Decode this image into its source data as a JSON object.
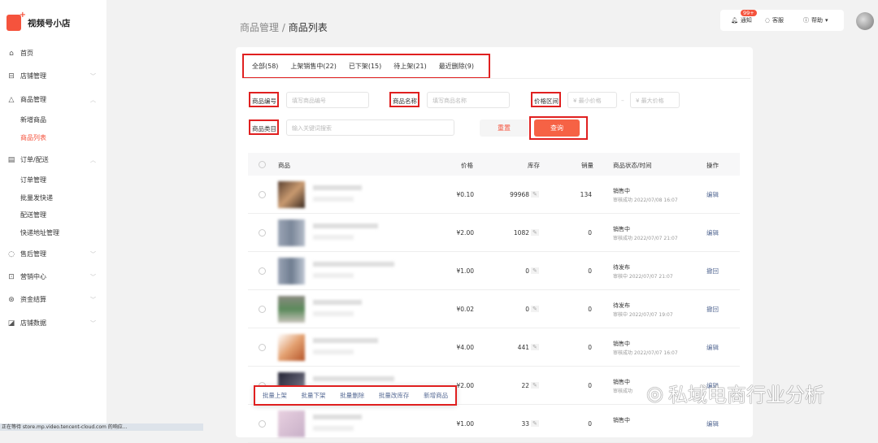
{
  "app": {
    "name": "视频号小店"
  },
  "sidebar": {
    "items": [
      {
        "label": "首页",
        "icon": "home-icon"
      },
      {
        "label": "店铺管理",
        "icon": "store-icon"
      },
      {
        "label": "商品管理",
        "icon": "bag-icon",
        "sub": [
          "新增商品",
          "商品列表"
        ]
      },
      {
        "label": "订单/配送",
        "icon": "order-icon",
        "sub": [
          "订单管理",
          "批量发快递",
          "配送管理",
          "快递地址管理"
        ]
      },
      {
        "label": "售后管理",
        "icon": "headset-icon"
      },
      {
        "label": "营销中心",
        "icon": "marketing-icon"
      },
      {
        "label": "资金结算",
        "icon": "yuan-icon"
      },
      {
        "label": "店铺数据",
        "icon": "chart-icon"
      }
    ]
  },
  "topbar": {
    "notify": "通知",
    "badge": "99+",
    "service": "客服",
    "help": "帮助"
  },
  "breadcrumb": {
    "parent": "商品管理",
    "sep": " / ",
    "current": "商品列表"
  },
  "tabs": [
    "全部(58)",
    "上架销售中(22)",
    "已下架(15)",
    "待上架(21)",
    "最近删除(9)"
  ],
  "filters": {
    "code_label": "商品编号",
    "code_ph": "填写商品编号",
    "name_label": "商品名称",
    "name_ph": "填写商品名称",
    "price_label": "价格区间",
    "min_ph": "¥ 最小价格",
    "dash": "–",
    "max_ph": "¥ 最大价格",
    "cat_label": "商品类目",
    "cat_ph": "输入关键词搜索",
    "reset": "重置",
    "query": "查询"
  },
  "table": {
    "headers": [
      "商品",
      "价格",
      "库存",
      "销量",
      "商品状态/时间",
      "操作"
    ],
    "rows": [
      {
        "price": "¥0.10",
        "stock": "99968",
        "sales": "134",
        "status": "销售中",
        "time": "审核成功 2022/07/08 16:07",
        "op": "编辑"
      },
      {
        "price": "¥2.00",
        "stock": "1082",
        "sales": "0",
        "status": "销售中",
        "time": "审核成功 2022/07/07 21:07",
        "op": "编辑"
      },
      {
        "price": "¥1.00",
        "stock": "0",
        "sales": "0",
        "status": "待发布",
        "time": "审核中 2022/07/07 21:07",
        "op": "撤回"
      },
      {
        "price": "¥0.02",
        "stock": "0",
        "sales": "0",
        "status": "待发布",
        "time": "审核中 2022/07/07 19:07",
        "op": "撤回"
      },
      {
        "price": "¥4.00",
        "stock": "441",
        "sales": "0",
        "status": "销售中",
        "time": "审核成功 2022/07/07 16:07",
        "op": "编辑"
      },
      {
        "price": "¥2.00",
        "stock": "22",
        "sales": "0",
        "status": "销售中",
        "time": "审核成功",
        "op": "编辑"
      },
      {
        "price": "¥1.00",
        "stock": "33",
        "sales": "0",
        "status": "销售中",
        "time": "",
        "op": "编辑"
      }
    ]
  },
  "batch": [
    "批量上架",
    "批量下架",
    "批量删除",
    "批量改库存",
    "新增商品"
  ],
  "statusbar": "正在等待 store.mp.video.tencent-cloud.com 的响应...",
  "watermark": "私域电商行业分析",
  "colors": {
    "accent": "#f5533d",
    "link": "#576b95"
  }
}
